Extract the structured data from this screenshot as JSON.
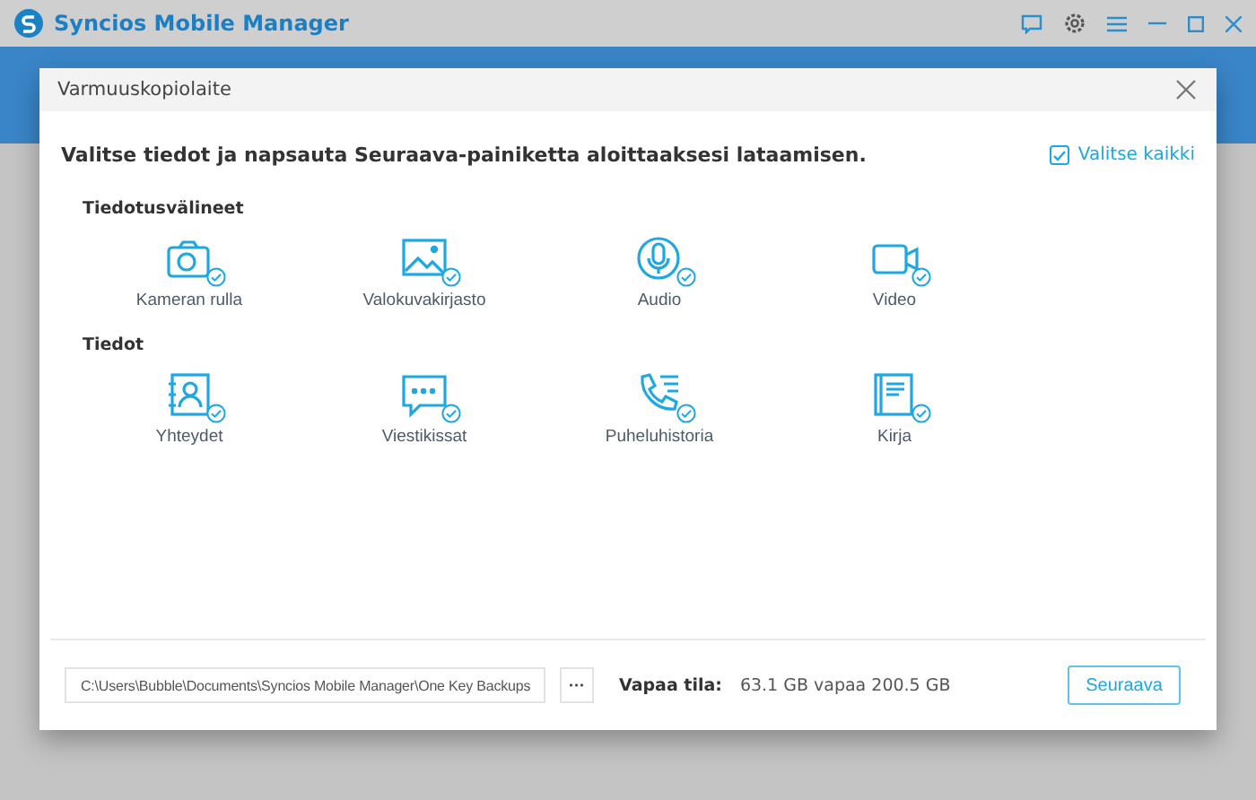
{
  "window": {
    "title": "Syncios Mobile Manager"
  },
  "dialog": {
    "title": "Varmuuskopiolaite",
    "instruction": "Valitse tiedot ja napsauta Seuraava-painiketta aloittaaksesi lataamisen.",
    "select_all": {
      "label": "Valitse kaikki",
      "checked": true
    },
    "sections": [
      {
        "title": "Tiedotusvälineet",
        "items": [
          {
            "kind": "camera",
            "label": "Kameran rulla",
            "checked": true
          },
          {
            "kind": "photo",
            "label": "Valokuvakirjasto",
            "checked": true
          },
          {
            "kind": "audio",
            "label": "Audio",
            "checked": true
          },
          {
            "kind": "video",
            "label": "Video",
            "checked": true
          }
        ]
      },
      {
        "title": "Tiedot",
        "items": [
          {
            "kind": "contacts",
            "label": "Yhteydet",
            "checked": true
          },
          {
            "kind": "messages",
            "label": "Viestikissat",
            "checked": true
          },
          {
            "kind": "calls",
            "label": "Puheluhistoria",
            "checked": true
          },
          {
            "kind": "book",
            "label": "Kirja",
            "checked": true
          }
        ]
      }
    ],
    "footer": {
      "path": "C:\\Users\\Bubble\\Documents\\Syncios Mobile Manager\\One Key Backups",
      "browse": "···",
      "free_label": "Vapaa tila:",
      "free_value": "63.1 GB vapaa 200.5 GB",
      "next": "Seuraava"
    }
  }
}
